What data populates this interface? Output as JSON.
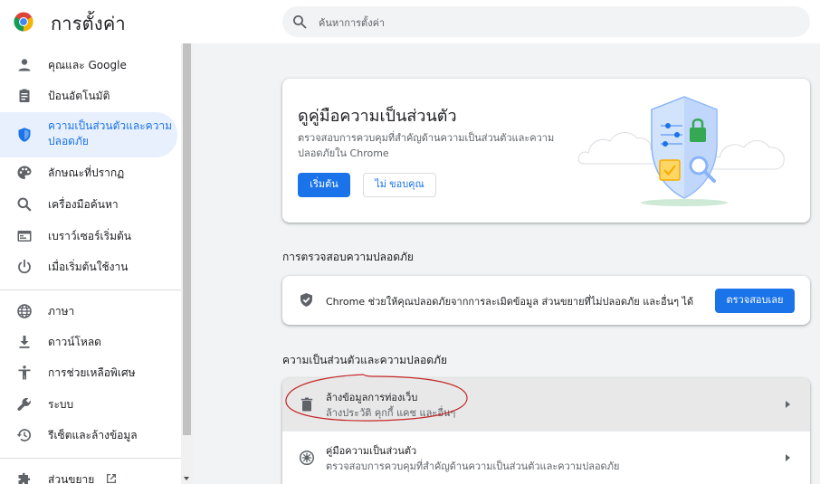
{
  "header": {
    "title": "การตั้งค่า",
    "search_placeholder": "ค้นหาการตั้งค่า"
  },
  "sidebar": {
    "items": [
      {
        "label": "คุณและ Google",
        "icon": "person-icon"
      },
      {
        "label": "ป้อนอัตโนมัติ",
        "icon": "clipboard-icon"
      },
      {
        "label": "ความเป็นส่วนตัวและความปลอดภัย",
        "label_line1": "ความเป็นส่วนตัวและความ",
        "label_line2": "ปลอดภัย",
        "icon": "shield-icon",
        "active": true
      },
      {
        "label": "ลักษณะที่ปรากฏ",
        "icon": "palette-icon"
      },
      {
        "label": "เครื่องมือค้นหา",
        "icon": "search-icon"
      },
      {
        "label": "เบราว์เซอร์เริ่มต้น",
        "icon": "browser-icon"
      },
      {
        "label": "เมื่อเริ่มต้นใช้งาน",
        "icon": "power-icon"
      },
      {
        "label": "ภาษา",
        "icon": "globe-icon"
      },
      {
        "label": "ดาวน์โหลด",
        "icon": "download-icon"
      },
      {
        "label": "การช่วยเหลือพิเศษ",
        "icon": "accessibility-icon"
      },
      {
        "label": "ระบบ",
        "icon": "wrench-icon"
      },
      {
        "label": "รีเซ็ตและล้างข้อมูล",
        "icon": "restore-icon"
      },
      {
        "label": "ส่วนขยาย",
        "icon": "puzzle-icon"
      }
    ]
  },
  "guide": {
    "title": "ดูคู่มือความเป็นส่วนตัว",
    "description": "ตรวจสอบการควบคุมที่สำคัญด้านความเป็นส่วนตัวและความปลอดภัยใน Chrome",
    "start_label": "เริ่มต้น",
    "no_thanks_label": "ไม่ ขอบคุณ"
  },
  "safety_check": {
    "section_title": "การตรวจสอบความปลอดภัย",
    "text": "Chrome ช่วยให้คุณปลอดภัยจากการละเมิดข้อมูล ส่วนขยายที่ไม่ปลอดภัย และอื่นๆ ได้",
    "button_label": "ตรวจสอบเลย"
  },
  "privacy": {
    "section_title": "ความเป็นส่วนตัวและความปลอดภัย",
    "rows": [
      {
        "title": "ล้างข้อมูลการท่องเว็บ",
        "subtitle": "ล้างประวัติ คุกกี้ แคช และอื่นๆ",
        "icon": "trash-icon"
      },
      {
        "title": "คู่มือความเป็นส่วนตัว",
        "subtitle": "ตรวจสอบการควบคุมที่สำคัญด้านความเป็นส่วนตัวและความปลอดภัย",
        "icon": "privacy-guide-icon"
      }
    ]
  },
  "colors": {
    "accent": "#1a73e8",
    "active_bg": "#e8f0fe",
    "annotation": "#c62828"
  }
}
